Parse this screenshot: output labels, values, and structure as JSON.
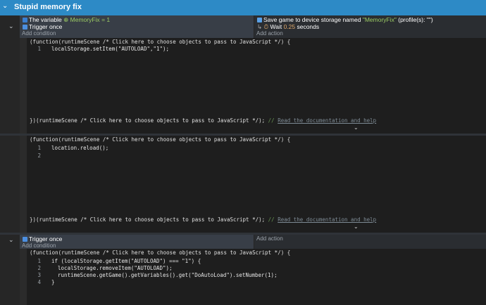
{
  "group": {
    "title": "Stupid memory fix"
  },
  "event1": {
    "conditions": [
      {
        "icon": "variable-icon",
        "prefix": "The variable",
        "var_name": "MemoryFix",
        "op": "= 1"
      },
      {
        "icon": "trigger-once-icon",
        "text": "Trigger once"
      }
    ],
    "add_condition": "Add condition",
    "actions": [
      {
        "icon": "save-icon",
        "text": "Save game to device storage named ",
        "name": "\"MemoryFix\"",
        "suffix": " (profile(s): \"\")"
      },
      {
        "icon": "timer-icon",
        "prefix": "Wait ",
        "value": "0.25",
        "suffix": " seconds"
      }
    ],
    "add_action": "Add action"
  },
  "js_header": "(function(runtimeScene /* Click here to choose objects to pass to JavaScript */) {",
  "js_footer_code": "})(runtimeScene /* Click here to choose objects to pass to JavaScript */);",
  "js_footer_comment": " // ",
  "js_footer_doc": "Read the documentation and help",
  "js1": {
    "lines": [
      {
        "n": "1",
        "code": "localStorage.setItem(\"AUTOLOAD\",\"1\");"
      }
    ]
  },
  "js2": {
    "lines": [
      {
        "n": "1",
        "code": "location.reload();"
      },
      {
        "n": "2",
        "code": ""
      }
    ]
  },
  "event2": {
    "conditions": [
      {
        "icon": "trigger-once-icon",
        "text": "Trigger once"
      }
    ],
    "add_condition": "Add condition",
    "add_action": "Add action"
  },
  "js3": {
    "lines": [
      {
        "n": "1",
        "code": "if (localStorage.getItem(\"AUTOLOAD\") === \"1\") {"
      },
      {
        "n": "2",
        "code": "  localStorage.removeItem(\"AUTOLOAD\");"
      },
      {
        "n": "3",
        "code": "  runtimeScene.getGame().getVariables().get(\"DoAutoLoad\").setNumber(1);"
      },
      {
        "n": "4",
        "code": "}"
      }
    ]
  },
  "colors": {
    "group_header": "#2d8ac6",
    "condition_bg": "#383e47",
    "code_bg": "#1e1e1e"
  }
}
